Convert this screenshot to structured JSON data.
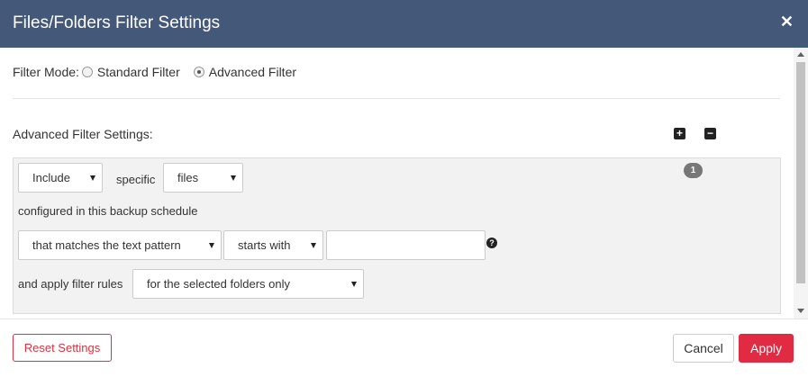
{
  "dialog": {
    "title": "Files/Folders Filter Settings",
    "close_glyph": "✕"
  },
  "filter_mode": {
    "label": "Filter Mode:",
    "options": [
      {
        "label": "Standard Filter",
        "selected": false
      },
      {
        "label": "Advanced Filter",
        "selected": true
      }
    ]
  },
  "advanced": {
    "label": "Advanced Filter Settings:",
    "add_icon": "plus-square-icon",
    "remove_icon": "minus-square-icon"
  },
  "rule": {
    "number": "1",
    "include_select": "Include",
    "specific_label": "specific",
    "type_select": "files",
    "configured_label": "configured in this backup schedule",
    "match_select": "that matches the text pattern",
    "position_select": "starts with",
    "pattern_value": "",
    "help_glyph": "?",
    "apply_label": "and apply filter rules",
    "scope_select": "for the selected folders only"
  },
  "footer": {
    "reset_label": "Reset Settings",
    "cancel_label": "Cancel",
    "apply_label": "Apply"
  },
  "colors": {
    "header_bg": "#44587a",
    "accent_red": "#e12b42",
    "panel_bg": "#f2f2f2"
  }
}
